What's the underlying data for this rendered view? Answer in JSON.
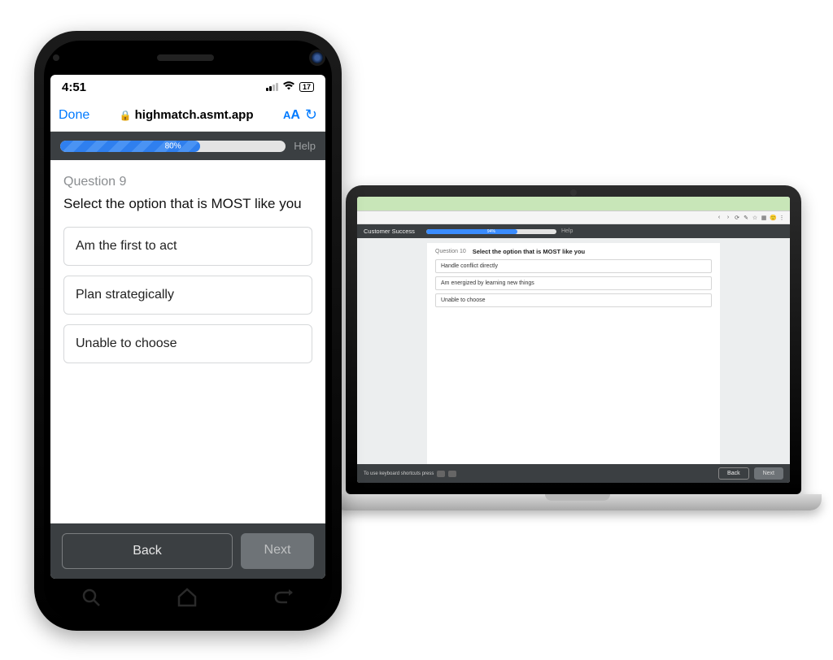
{
  "phone": {
    "status": {
      "time": "4:51",
      "battery": "17"
    },
    "safari": {
      "done": "Done",
      "url": "highmatch.asmt.app",
      "aa": "AA"
    },
    "progress": {
      "pct_label": "80%",
      "pct_value": 62,
      "help": "Help"
    },
    "question": {
      "number": "Question 9",
      "prompt": "Select the option that is MOST like you",
      "options": [
        "Am the first to act",
        "Plan strategically",
        "Unable to choose"
      ]
    },
    "footer": {
      "back": "Back",
      "next": "Next"
    }
  },
  "laptop": {
    "app_title": "Customer Success",
    "progress": {
      "pct_label": "94%",
      "pct_value": 70,
      "help": "Help"
    },
    "question": {
      "number": "Question 10",
      "prompt": "Select the option that is MOST like you",
      "options": [
        "Handle conflict directly",
        "Am energized by learning new things",
        "Unable to choose"
      ]
    },
    "footer": {
      "keyboard_hint": "To use keyboard shortcuts press",
      "back": "Back",
      "next": "Next"
    }
  }
}
